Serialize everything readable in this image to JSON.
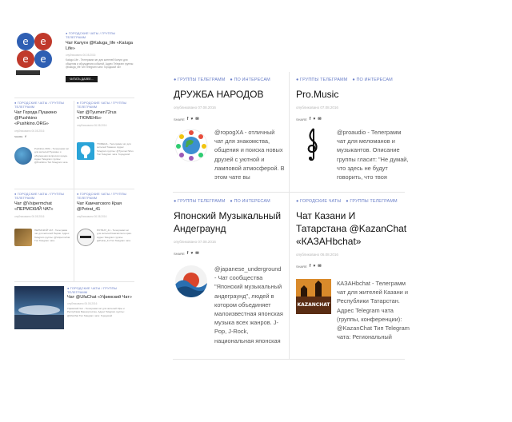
{
  "left": {
    "feature": {
      "tags": "● ГОРОДСКИЕ ЧАТЫ / ГРУППЫ ТЕЛЕГРАММ",
      "title": "Чат Калуги @Kaluga_life «Kaluga Life»",
      "date": "опубликовано 06.08.2016",
      "excerpt": "Kaluga Life - Телеграмм чат для жителей Калуги для общения и обсуждения событий. Адрес Telegram группы: @kaluga_life Тип Telegram чата: Городской чат",
      "read_more": "ЧИТАТЬ ДАЛЕЕ..."
    },
    "cards": [
      {
        "tags": "● ГОРОДСКИЕ ЧАТЫ / ГРУППЫ ТЕЛЕГРАММ",
        "title": "Чат Города Пушкино @Pushkino «Pushkino.ORG»",
        "date": "опубликовано 06.08.2016",
        "excerpt": "Pushkino.ORG - Телеграмм чат для жителей Пушкино и обсуждения вопросов города. Адрес Telegram группы: @Pushkino Тип Telegram чата"
      },
      {
        "tags": "● ГОРОДСКИЕ ЧАТЫ / ГРУППЫ ТЕЛЕГРАММ",
        "title": "Чат @Tyumen72rus «ТЮМЕНЬ»",
        "date": "опубликовано 06.08.2016",
        "excerpt": "ТЮМЕНЬ - Телеграмм чат для жителей Тюмени. Адрес Telegram группы: @Tyumen72rus Тип Telegram чата: Городской"
      },
      {
        "tags": "● ГОРОДСКИЕ ЧАТЫ / ГРУППЫ ТЕЛЕГРАММ",
        "title": "Чат @Vsipermchat «ПЕРМСКИЙ ЧАТ»",
        "date": "опубликовано 06.08.2016",
        "excerpt": "ПЕРМСКИЙ ЧАТ - Телеграмм чат для жителей Перми. Адрес Telegram группы: @Vsipermchat Тип Telegram чата"
      },
      {
        "tags": "● ГОРОДСКИЕ ЧАТЫ / ГРУППЫ ТЕЛЕГРАММ",
        "title": "Чат Камчатского Края @Potrat_41",
        "date": "опубликовано 06.08.2016",
        "excerpt": "POTRAT_41 - Телеграмм чат для жителей Камчатского края. Адрес Telegram группы: @Potrat_41 Тип Telegram чата"
      }
    ],
    "bottom": {
      "tags": "● ГОРОДСКИЕ ЧАТЫ / ГРУППЫ ТЕЛЕГРАММ",
      "title": "Чат @UfaChat «Уфимский Чат»",
      "date": "опубликовано 06.08.2016",
      "excerpt": "Уфимский Чат - Телеграмм чат для жителей Уфы и Республики Башкортостан. Адрес Telegram группы: @UfaChat Тип Telegram чата: Городской"
    }
  },
  "share_label": "SHARE",
  "share_icons": [
    "f",
    "♥",
    "✉"
  ],
  "cards": [
    {
      "tags": [
        "● ГРУППЫ ТЕЛЕГРАММ",
        "● ПО ИНТЕРЕСАМ"
      ],
      "title": "ДРУЖБА НАРОДОВ",
      "date": "опубликовано 07.08.2016",
      "excerpt": "@ropogXA - отличный чат для знакомства, общения и поиска новых друзей с уютной и ламповой атмосферой. В этом чате вы",
      "image": "globe"
    },
    {
      "tags": [
        "● ГРУППЫ ТЕЛЕГРАММ",
        "● ПО ИНТЕРЕСАМ"
      ],
      "title": "Pro.Music",
      "date": "опубликовано 07.08.2016",
      "excerpt": "@proaudio - Телеграмм чат для меломанов и музыкантов. Описание группы гласит: \"Не думай, что здесь не будут говорить, что твоя",
      "image": "treble-clef"
    },
    {
      "tags": [
        "● ГРУППЫ ТЕЛЕГРАММ",
        "● ПО ИНТЕРЕСАМ"
      ],
      "title": "Японский Музыкальный Андеграунд",
      "date": "опубликовано 07.08.2016",
      "excerpt": "@japanese_underground - Чат сообщества \"Японский музыкальный андеграунд\", людей в котором объединяет малоизвестная японская музыка всех жанров. J-Pop, J-Rock, национальная японская",
      "image": "wave"
    },
    {
      "tags": [
        "● ГОРОДСКИЕ ЧАТЫ",
        "● ГРУППЫ ТЕЛЕГРАММ"
      ],
      "title": "Чат Казани И Татарстана @KazanChat «КАЗАНbchat»",
      "date": "опубликовано 06.08.2016",
      "excerpt": "КАЗАНbchat - Телеграмм чат для жителей Казани и Республики Татарстан. Адрес Telegram чата (группы, конференции): @KazanChat Тип Telegram чата: Региональный",
      "image": "kazan"
    }
  ]
}
